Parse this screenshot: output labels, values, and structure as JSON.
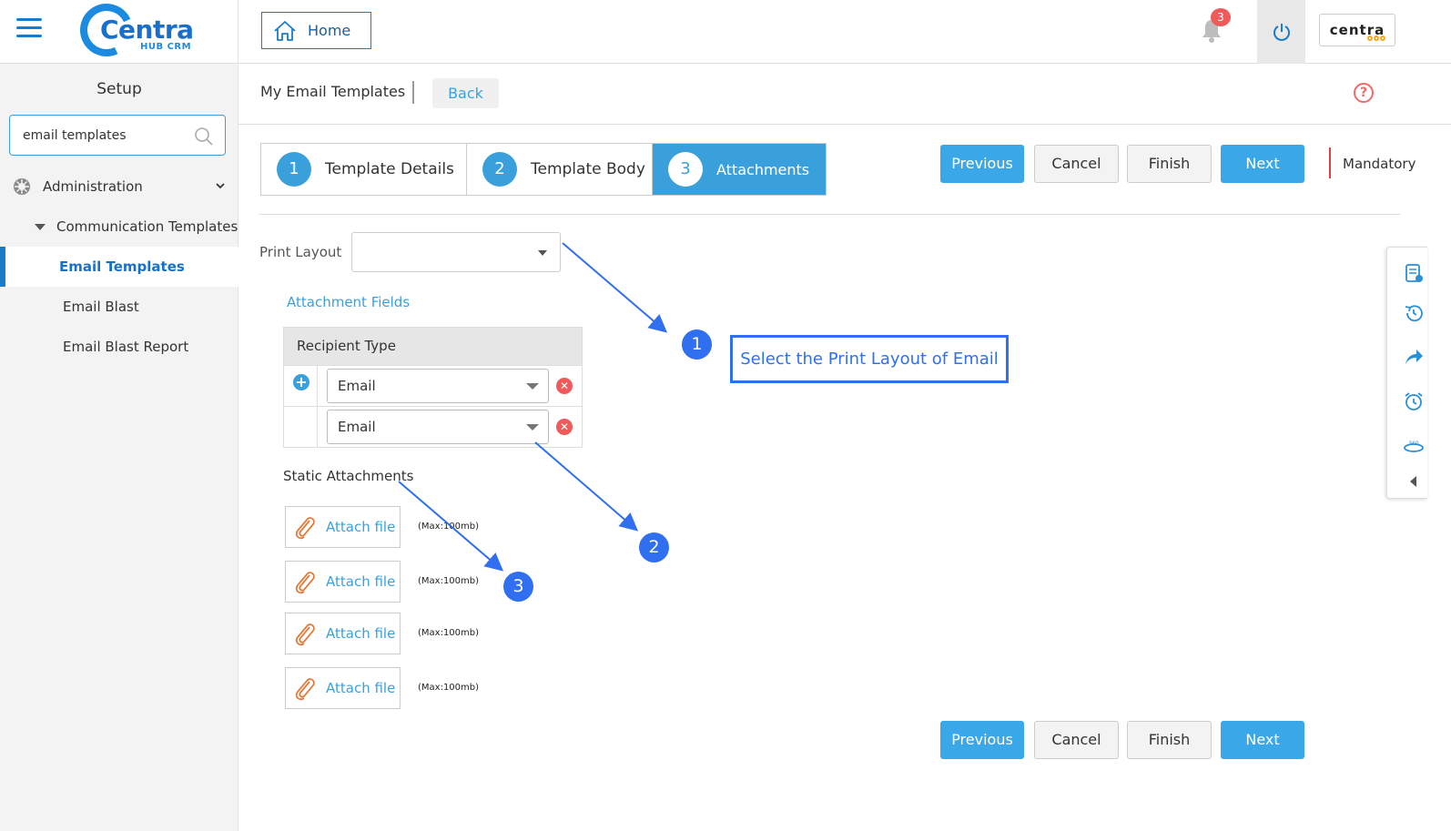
{
  "header": {
    "logo_text": "Centra",
    "logo_sub": "HUB CRM",
    "home_label": "Home",
    "notification_count": "3",
    "brand_label": "centra"
  },
  "sidebar": {
    "title": "Setup",
    "search_value": "email templates",
    "admin_label": "Administration",
    "comm_label": "Communication Templates",
    "items": [
      {
        "label": "Email Templates",
        "active": true
      },
      {
        "label": "Email Blast",
        "active": false
      },
      {
        "label": "Email Blast Report",
        "active": false
      }
    ]
  },
  "page": {
    "title": "My Email Templates",
    "back_label": "Back",
    "help_symbol": "?"
  },
  "steps": [
    {
      "number": "1",
      "label": "Template Details"
    },
    {
      "number": "2",
      "label": "Template Body"
    },
    {
      "number": "3",
      "label": "Attachments",
      "active": true
    }
  ],
  "actions": {
    "previous": "Previous",
    "cancel": "Cancel",
    "finish": "Finish",
    "next": "Next",
    "mandatory": "Mandatory"
  },
  "form": {
    "print_layout_label": "Print Layout",
    "print_layout_value": "",
    "attachment_fields_label": "Attachment Fields",
    "recipient_type_header": "Recipient Type",
    "recipients": [
      "Email",
      "Email"
    ],
    "static_attachments_label": "Static Attachments",
    "attach_label": "Attach file",
    "max_note": "(Max:100mb)"
  },
  "annotations": {
    "step1": "1",
    "step2": "2",
    "step3": "3",
    "callout": "Select the Print Layout of Email"
  },
  "colors": {
    "primary": "#3aa8e8",
    "accent_blue": "#1a7cc8",
    "annotation": "#2f6ff0",
    "danger": "#f05a5a"
  }
}
